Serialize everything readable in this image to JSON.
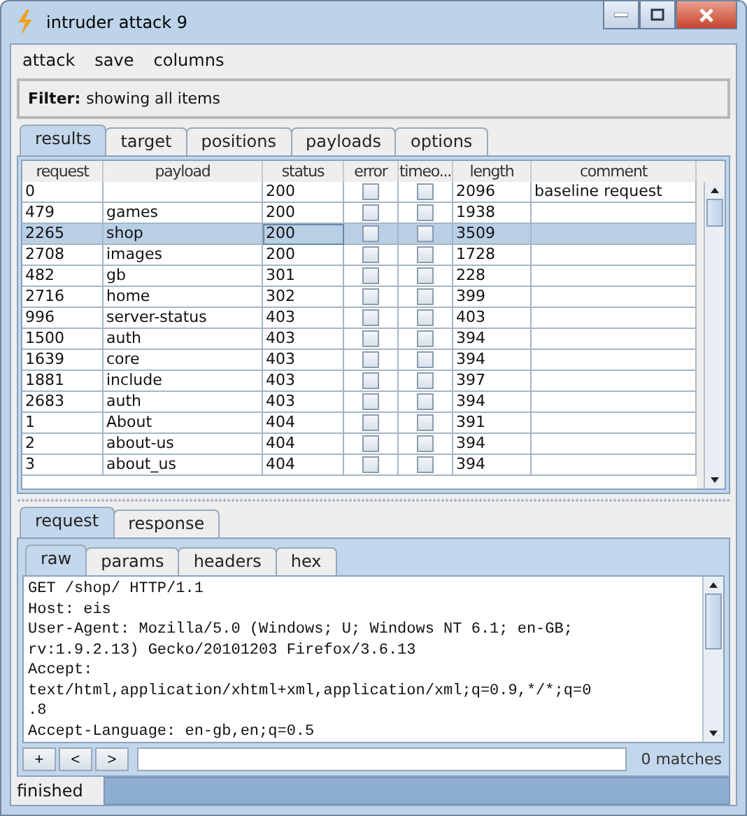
{
  "window": {
    "title": "intruder attack 9"
  },
  "menu": [
    "attack",
    "save",
    "columns"
  ],
  "filter": {
    "label": "Filter:",
    "text": "showing all items"
  },
  "tabs": [
    {
      "label": "results",
      "selected": true
    },
    {
      "label": "target",
      "selected": false
    },
    {
      "label": "positions",
      "selected": false
    },
    {
      "label": "payloads",
      "selected": false
    },
    {
      "label": "options",
      "selected": false
    }
  ],
  "table": {
    "columns": [
      "request",
      "payload",
      "status",
      "error",
      "timeo...",
      "length",
      "comment"
    ],
    "rows": [
      {
        "request": "0",
        "payload": "",
        "status": "200",
        "error": false,
        "timeout": false,
        "length": "2096",
        "comment": "baseline request",
        "selected": false
      },
      {
        "request": "479",
        "payload": "games",
        "status": "200",
        "error": false,
        "timeout": false,
        "length": "1938",
        "comment": "",
        "selected": false
      },
      {
        "request": "2265",
        "payload": "shop",
        "status": "200",
        "error": false,
        "timeout": false,
        "length": "3509",
        "comment": "",
        "selected": true
      },
      {
        "request": "2708",
        "payload": "images",
        "status": "200",
        "error": false,
        "timeout": false,
        "length": "1728",
        "comment": "",
        "selected": false
      },
      {
        "request": "482",
        "payload": "gb",
        "status": "301",
        "error": false,
        "timeout": false,
        "length": "228",
        "comment": "",
        "selected": false
      },
      {
        "request": "2716",
        "payload": "home",
        "status": "302",
        "error": false,
        "timeout": false,
        "length": "399",
        "comment": "",
        "selected": false
      },
      {
        "request": "996",
        "payload": "server-status",
        "status": "403",
        "error": false,
        "timeout": false,
        "length": "403",
        "comment": "",
        "selected": false
      },
      {
        "request": "1500",
        "payload": "auth",
        "status": "403",
        "error": false,
        "timeout": false,
        "length": "394",
        "comment": "",
        "selected": false
      },
      {
        "request": "1639",
        "payload": "core",
        "status": "403",
        "error": false,
        "timeout": false,
        "length": "394",
        "comment": "",
        "selected": false
      },
      {
        "request": "1881",
        "payload": "include",
        "status": "403",
        "error": false,
        "timeout": false,
        "length": "397",
        "comment": "",
        "selected": false
      },
      {
        "request": "2683",
        "payload": "auth",
        "status": "403",
        "error": false,
        "timeout": false,
        "length": "394",
        "comment": "",
        "selected": false
      },
      {
        "request": "1",
        "payload": "About",
        "status": "404",
        "error": false,
        "timeout": false,
        "length": "391",
        "comment": "",
        "selected": false
      },
      {
        "request": "2",
        "payload": "about-us",
        "status": "404",
        "error": false,
        "timeout": false,
        "length": "394",
        "comment": "",
        "selected": false
      },
      {
        "request": "3",
        "payload": "about_us",
        "status": "404",
        "error": false,
        "timeout": false,
        "length": "394",
        "comment": "",
        "selected": false
      }
    ]
  },
  "message_tabs": [
    {
      "label": "request",
      "selected": true
    },
    {
      "label": "response",
      "selected": false
    }
  ],
  "view_tabs": [
    {
      "label": "raw",
      "selected": true
    },
    {
      "label": "params",
      "selected": false
    },
    {
      "label": "headers",
      "selected": false
    },
    {
      "label": "hex",
      "selected": false
    }
  ],
  "raw_lines": [
    "GET /shop/ HTTP/1.1",
    "Host: eis",
    "User-Agent: Mozilla/5.0 (Windows; U; Windows NT 6.1; en-GB;",
    "rv:1.9.2.13) Gecko/20101203 Firefox/3.6.13",
    "Accept:",
    "text/html,application/xhtml+xml,application/xml;q=0.9,*/*;q=0",
    ".8",
    "Accept-Language: en-gb,en;q=0.5"
  ],
  "search": {
    "buttons": [
      "+",
      "<",
      ">"
    ],
    "matches": "0 matches"
  },
  "status_bar": {
    "text": "finished",
    "level": 1
  }
}
